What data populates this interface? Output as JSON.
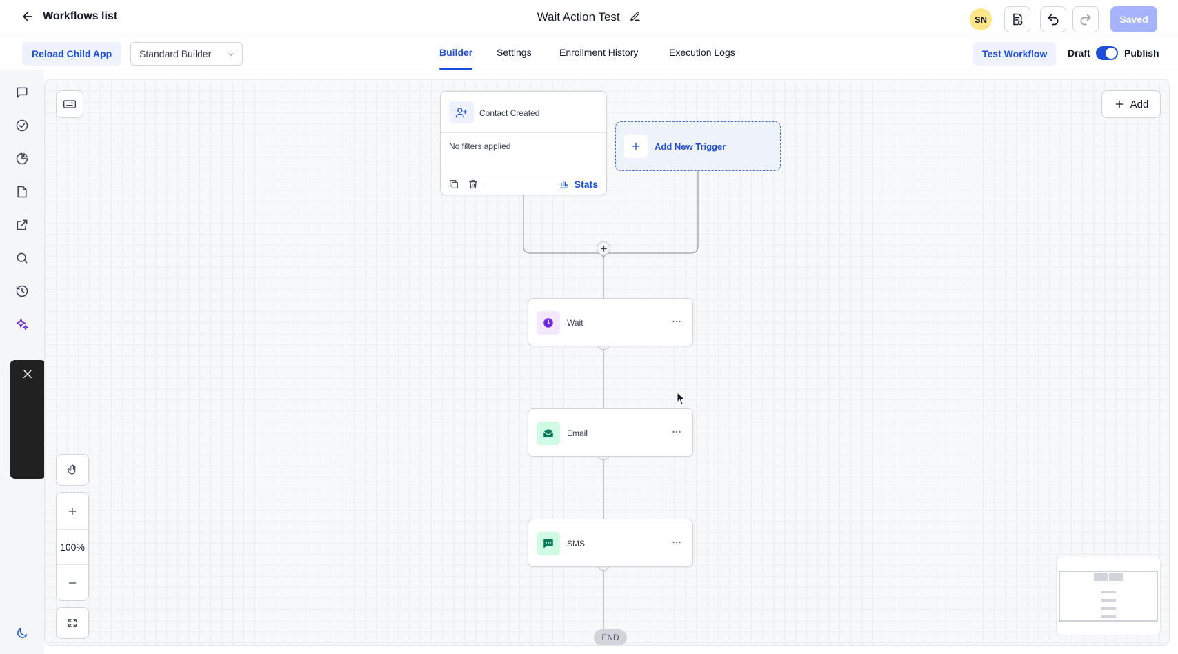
{
  "header": {
    "back_label": "Workflows list",
    "workflow_title": "Wait Action Test",
    "user_initials": "SN",
    "saved_label": "Saved"
  },
  "toolbar": {
    "reload_label": "Reload Child App",
    "builder_selected": "Standard Builder",
    "tabs": [
      {
        "label": "Builder",
        "active": true
      },
      {
        "label": "Settings",
        "active": false
      },
      {
        "label": "Enrollment History",
        "active": false
      },
      {
        "label": "Execution Logs",
        "active": false
      }
    ],
    "test_workflow_label": "Test Workflow",
    "draft_label": "Draft",
    "publish_label": "Publish",
    "publish_toggle_on": true
  },
  "sidebar": {
    "icons": [
      "chat-icon",
      "check-circle-icon",
      "pie-chart-icon",
      "file-icon",
      "external-link-icon",
      "search-icon",
      "history-icon",
      "sparkles-icon",
      "moon-icon"
    ]
  },
  "canvas": {
    "add_label": "Add",
    "zoom_level": "100%",
    "trigger": {
      "name": "Contact Created",
      "filters_text": "No filters applied",
      "stats_label": "Stats"
    },
    "add_trigger_label": "Add New Trigger",
    "actions": [
      {
        "name": "Wait",
        "icon": "clock-icon",
        "color": "#6d28d9",
        "bg": "#f3e8ff"
      },
      {
        "name": "Email",
        "icon": "envelope-icon",
        "color": "#047857",
        "bg": "#d1fae5"
      },
      {
        "name": "SMS",
        "icon": "message-icon",
        "color": "#047857",
        "bg": "#d1fae5"
      }
    ],
    "end_label": "END"
  },
  "colors": {
    "accent": "#1d4ed8",
    "saved_button": "#a5b4fc",
    "avatar_bg": "#fde68a"
  }
}
